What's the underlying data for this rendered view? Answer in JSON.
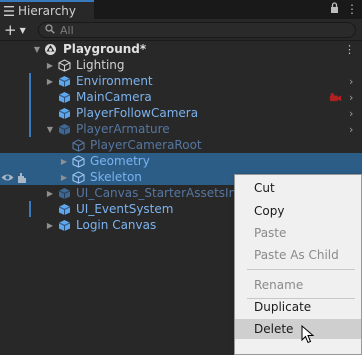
{
  "tab": {
    "title": "Hierarchy",
    "lock_glyph": "🔒",
    "menu_glyph": "⋮"
  },
  "toolbar": {
    "add_glyph": "+",
    "search_placeholder": "All"
  },
  "tree": {
    "scene": "Playground*",
    "items": [
      {
        "label": "Lighting"
      },
      {
        "label": "Environment"
      },
      {
        "label": "MainCamera"
      },
      {
        "label": "PlayerFollowCamera"
      },
      {
        "label": "PlayerArmature"
      },
      {
        "label": "PlayerCameraRoot"
      },
      {
        "label": "Geometry"
      },
      {
        "label": "Skeleton"
      },
      {
        "label": "UI_Canvas_StarterAssetsInputs"
      },
      {
        "label": "UI_EventSystem"
      },
      {
        "label": "Login Canvas"
      }
    ]
  },
  "context_menu": {
    "items": [
      {
        "label": "Cut"
      },
      {
        "label": "Copy"
      },
      {
        "label": "Paste"
      },
      {
        "label": "Paste As Child"
      },
      {
        "label": "Rename"
      },
      {
        "label": "Duplicate"
      },
      {
        "label": "Delete"
      }
    ]
  },
  "colors": {
    "accent": "#3a79bb",
    "prefab_text": "#7cb3ef",
    "selection": "#2c5d87"
  }
}
